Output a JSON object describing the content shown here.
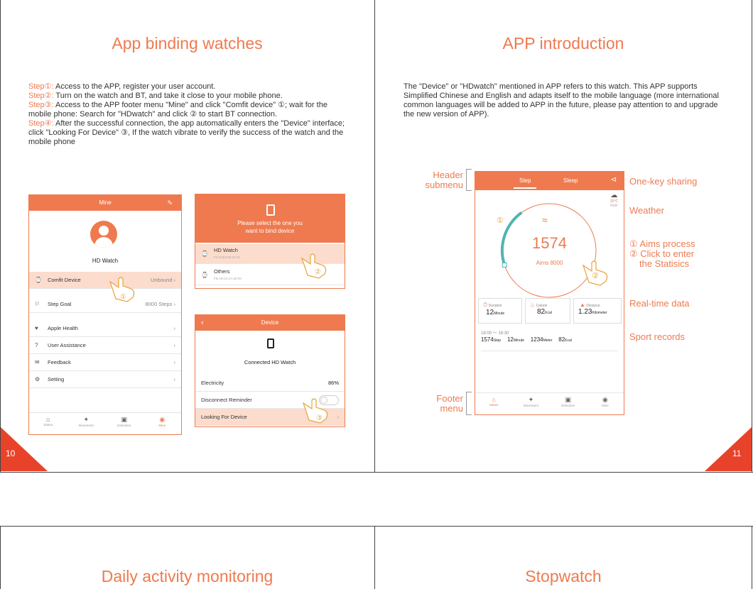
{
  "left_page": {
    "title": "App binding watches",
    "steps": [
      {
        "label": "Step①:",
        "text": " Access to the APP, register your user account."
      },
      {
        "label": "Step②:",
        "text": " Turn on the watch and BT, and take it close to your mobile phone."
      },
      {
        "label": "Step③:",
        "text": " Access to the APP footer menu \"Mine\" and click \"Comfit device\" ①; wait for the mobile phone: Search for \"HDwatch\" and click ② to start BT connection."
      },
      {
        "label": "Step④:",
        "text": " After the successful connection, the app automatically enters the \"Device\" interface; click \"Looking For Device\" ③, If the watch vibrate to verify the success of the watch and the mobile phone"
      }
    ],
    "page_number": "10"
  },
  "mine_screen": {
    "header": "Mine",
    "user_name": "HD Watch",
    "rows": [
      {
        "label": "Comfit Device",
        "value": "Unbound"
      },
      {
        "label": "Step Goal",
        "value": "8000 Steps"
      },
      {
        "label": "Apple Health",
        "value": ""
      },
      {
        "label": "User Assistance",
        "value": ""
      },
      {
        "label": "Feedback",
        "value": ""
      },
      {
        "label": "Setting",
        "value": ""
      }
    ],
    "tabs": [
      "Status",
      "Movement",
      "Detection",
      "Mine"
    ],
    "marker": "①"
  },
  "bind_screen": {
    "prompt_line1": "Please select the one you",
    "prompt_line2": "want to bind device",
    "devices": [
      {
        "name": "HD Watch",
        "mac": "F2:18:E3:55:32:21"
      },
      {
        "name": "Others",
        "mac": "FB:A8:C4:1A:38:09"
      }
    ],
    "marker": "②"
  },
  "device_screen": {
    "header": "Device",
    "status": "Connected HD Watch",
    "electricity_label": "Electricity",
    "electricity_value": "86%",
    "reminder_label": "Disconnect Reminder",
    "find_label": "Looking For Device",
    "marker": "③"
  },
  "right_page": {
    "title": "APP introduction",
    "intro": "The \"Device\" or \"HDwatch\" mentioned in APP refers to this watch. This APP supports Simplified Chinese and English and adapts itself to the mobile language (more international common languages will be added to APP in the future, please pay attention to and upgrade the new version of APP).",
    "page_number": "11",
    "callouts": {
      "header_submenu": "Header submenu",
      "footer_menu": "Footer menu",
      "sharing": "One-key sharing",
      "weather": "Weather",
      "aims_line1": "① Aims process",
      "aims_line2": "② Click to enter",
      "aims_line3": "the Statisics",
      "realtime": "Real-time data",
      "sport": "Sport records"
    }
  },
  "status_screen": {
    "tab_step": "Step",
    "tab_sleep": "Sleep",
    "temp": "20℃",
    "weather": "Rain",
    "steps": "1574",
    "aims": "Aims 8000",
    "marker1": "①",
    "marker2": "②",
    "progress": 0.2,
    "cards": [
      {
        "label": "Duration",
        "value": "12",
        "unit": "Minute"
      },
      {
        "label": "Calorie",
        "value": "82",
        "unit": "Kcal"
      },
      {
        "label": "Distance",
        "value": "1.23",
        "unit": "Kilometer"
      }
    ],
    "record_time": "18:00 ～ 18:30",
    "record": [
      {
        "value": "1574",
        "unit": "Step"
      },
      {
        "value": "12",
        "unit": "Minute"
      },
      {
        "value": "1234",
        "unit": "Meter"
      },
      {
        "value": "82",
        "unit": "Kcal"
      }
    ],
    "tabs": [
      "Status",
      "Movement",
      "Detection",
      "Mine"
    ]
  },
  "bottom_left": {
    "title": "Daily activity monitoring"
  },
  "bottom_right": {
    "title": "Stopwatch"
  },
  "colors": {
    "accent": "#ee7a4f",
    "header": "#ef7a4f",
    "teal": "#4fb5b0",
    "highlight": "#fbdccd"
  }
}
